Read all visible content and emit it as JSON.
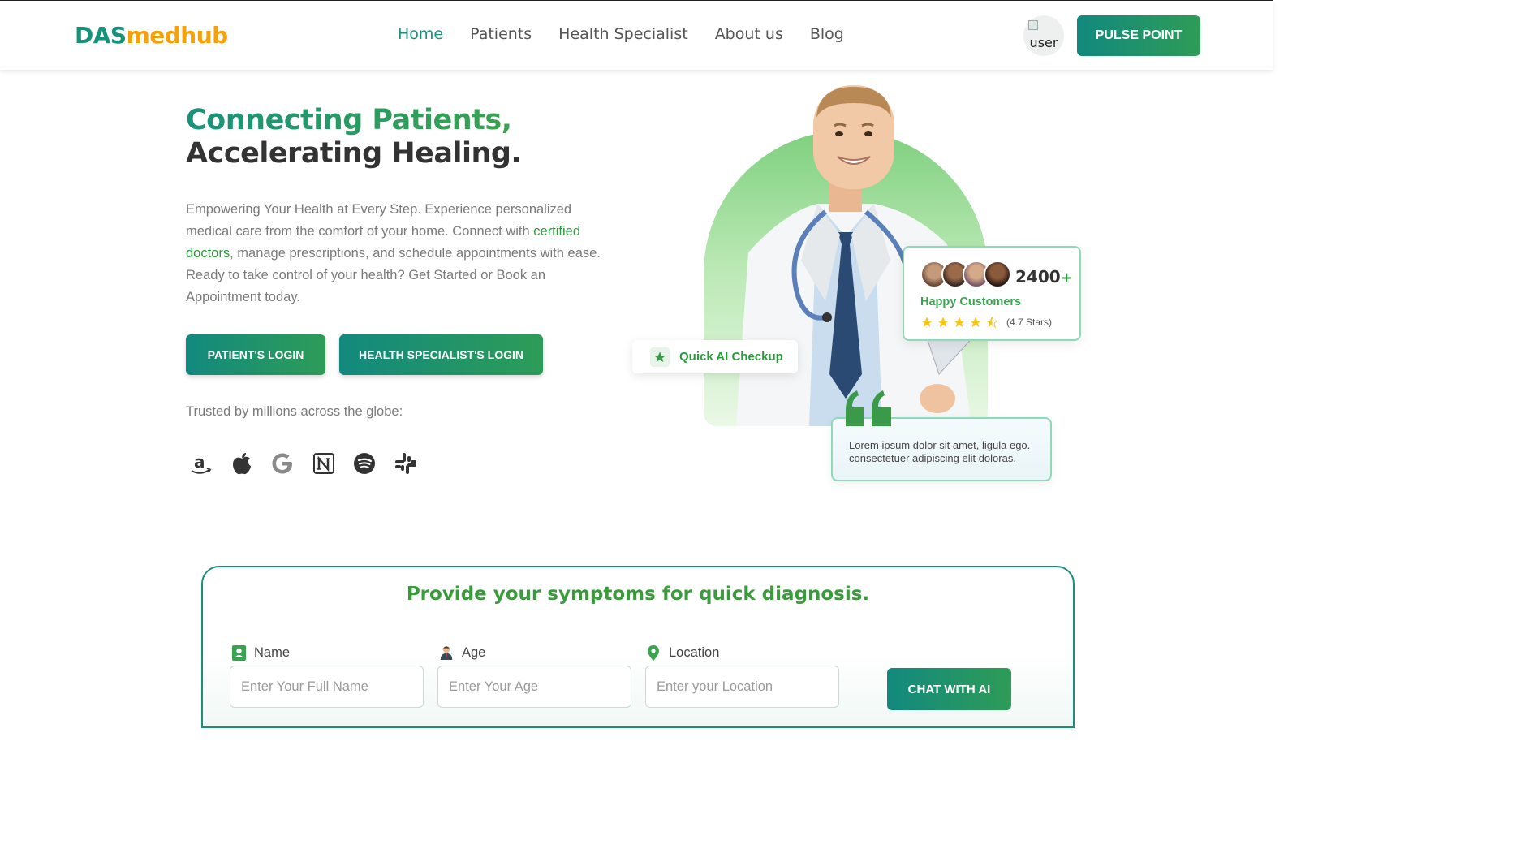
{
  "nav": {
    "logo_part1": "DAS",
    "logo_part2": "medhub",
    "links": [
      "Home",
      "Patients",
      "Health Specialist",
      "About us",
      "Blog"
    ],
    "avatar_alt": "user",
    "cta": "PULSE POINT"
  },
  "hero": {
    "title_line1": "Connecting Patients,",
    "title_line2": "Accelerating Healing.",
    "para_before": "Empowering Your Health at Every Step. Experience personalized medical care from the comfort of your home. Connect with ",
    "para_highlight": "certified doctors",
    "para_after": ", manage prescriptions, and schedule appointments with ease. Ready to take control of your health? Get Started or Book an Appointment today.",
    "patient_login": "PATIENT'S LOGIN",
    "specialist_login": "HEALTH SPECIALIST'S LOGIN",
    "trusted": "Trusted by millions across the globe:",
    "brands": [
      "amazon-icon",
      "apple-icon",
      "google-icon",
      "notion-icon",
      "spotify-icon",
      "slack-icon"
    ]
  },
  "stats_card": {
    "count": "2400",
    "plus": "+",
    "label": "Happy Customers",
    "stars": 4.5,
    "rating": "(4.7 Stars)"
  },
  "quick_checkup": {
    "label": "Quick AI Checkup"
  },
  "quote_card": {
    "text": "Lorem ipsum dolor sit amet, ligula ego. consectetuer adipiscing elit doloras."
  },
  "diagnosis": {
    "title": "Provide your symptoms for quick diagnosis.",
    "name_label": "Name",
    "name_placeholder": "Enter Your Full Name",
    "age_label": "Age",
    "age_placeholder": "Enter Your Age",
    "location_label": "Location",
    "location_placeholder": "Enter your Location",
    "submit": "CHAT WITH AI"
  },
  "colors": {
    "brand_teal": "#17927a",
    "brand_green": "#3aa34f",
    "logo_orange": "#f5a20a",
    "star": "#f5c518"
  }
}
